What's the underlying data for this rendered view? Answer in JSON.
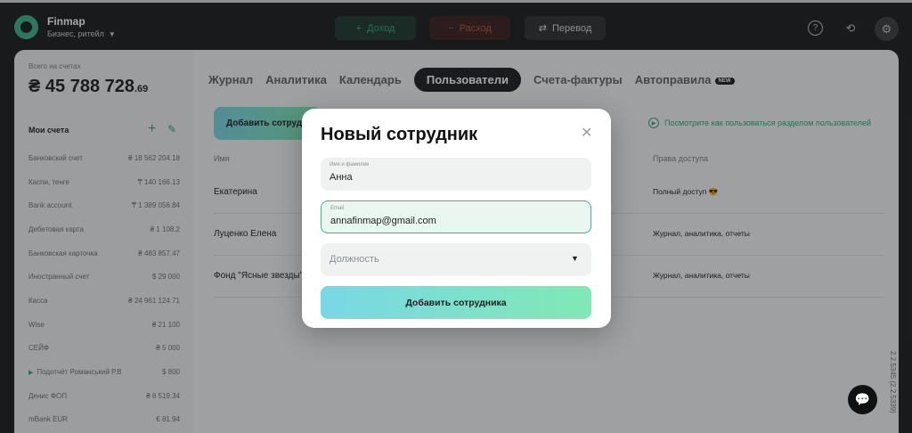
{
  "app": {
    "name": "Finmap",
    "business": "Бизнес, ритейл"
  },
  "toolbar": {
    "income_label": "Доход",
    "expense_label": "Расход",
    "transfer_label": "Перевод"
  },
  "sidebar": {
    "total_label": "Всего на счетах",
    "total_amount": "₴ 45 788 728",
    "total_cents": ".69",
    "accounts_heading": "Мои счета",
    "accounts": [
      {
        "name": "Банковский счет",
        "amount": "₴ 18 562 204.18"
      },
      {
        "name": "Каспи, тенге",
        "amount": "₸ 140 166.13"
      },
      {
        "name": "Bank account",
        "amount": "₸ 1 389 056.84"
      },
      {
        "name": "Дебетовая карта",
        "amount": "₴ 1 108.2"
      },
      {
        "name": "Банковская карточка",
        "amount": "₴ 483 857.47"
      },
      {
        "name": "Иностранный счет",
        "amount": "$ 29 000"
      },
      {
        "name": "Касса",
        "amount": "₴ 24 961 124.71"
      },
      {
        "name": "Wise",
        "amount": "₴ 21 100"
      },
      {
        "name": "СЕЙФ",
        "amount": "₴ 5 000"
      },
      {
        "name": "Подотчёт Романський Р.В",
        "amount": "$ 800"
      },
      {
        "name": "Денис ФОП",
        "amount": "₴ 8 519.34"
      },
      {
        "name": "mBank EUR",
        "amount": "€ 81.94"
      }
    ]
  },
  "tabs": [
    "Журнал",
    "Аналитика",
    "Календарь",
    "Пользователи",
    "Счета-фактуры",
    "Автоправила"
  ],
  "tab_badge": "NEW",
  "users_page": {
    "add_button": "Добавить сотрудника",
    "help_link": "Посмотрите как пользоваться разделом пользователей",
    "col_name": "Имя",
    "col_access": "Права доступа",
    "rows": [
      {
        "name": "Екатерина",
        "access": "Полный доступ 😎"
      },
      {
        "name": "Луценко Елена",
        "access": "Журнал, аналитика, отчеты"
      },
      {
        "name": "Фонд \"Ясные звезды\"",
        "access": "Журнал, аналитика, отчеты"
      }
    ]
  },
  "version": "2.2.5345 (2.2.5339)",
  "modal": {
    "title": "Новый сотрудник",
    "name_label": "Имя и фамилия",
    "name_value": "Анна",
    "email_label": "Email",
    "email_value": "annafinmap@gmail.com",
    "position_placeholder": "Должность",
    "submit_label": "Добавить сотрудника"
  },
  "colors": {
    "accent": "#2fa979",
    "gradient_start": "#7ad7e6",
    "gradient_end": "#80e9b4"
  }
}
